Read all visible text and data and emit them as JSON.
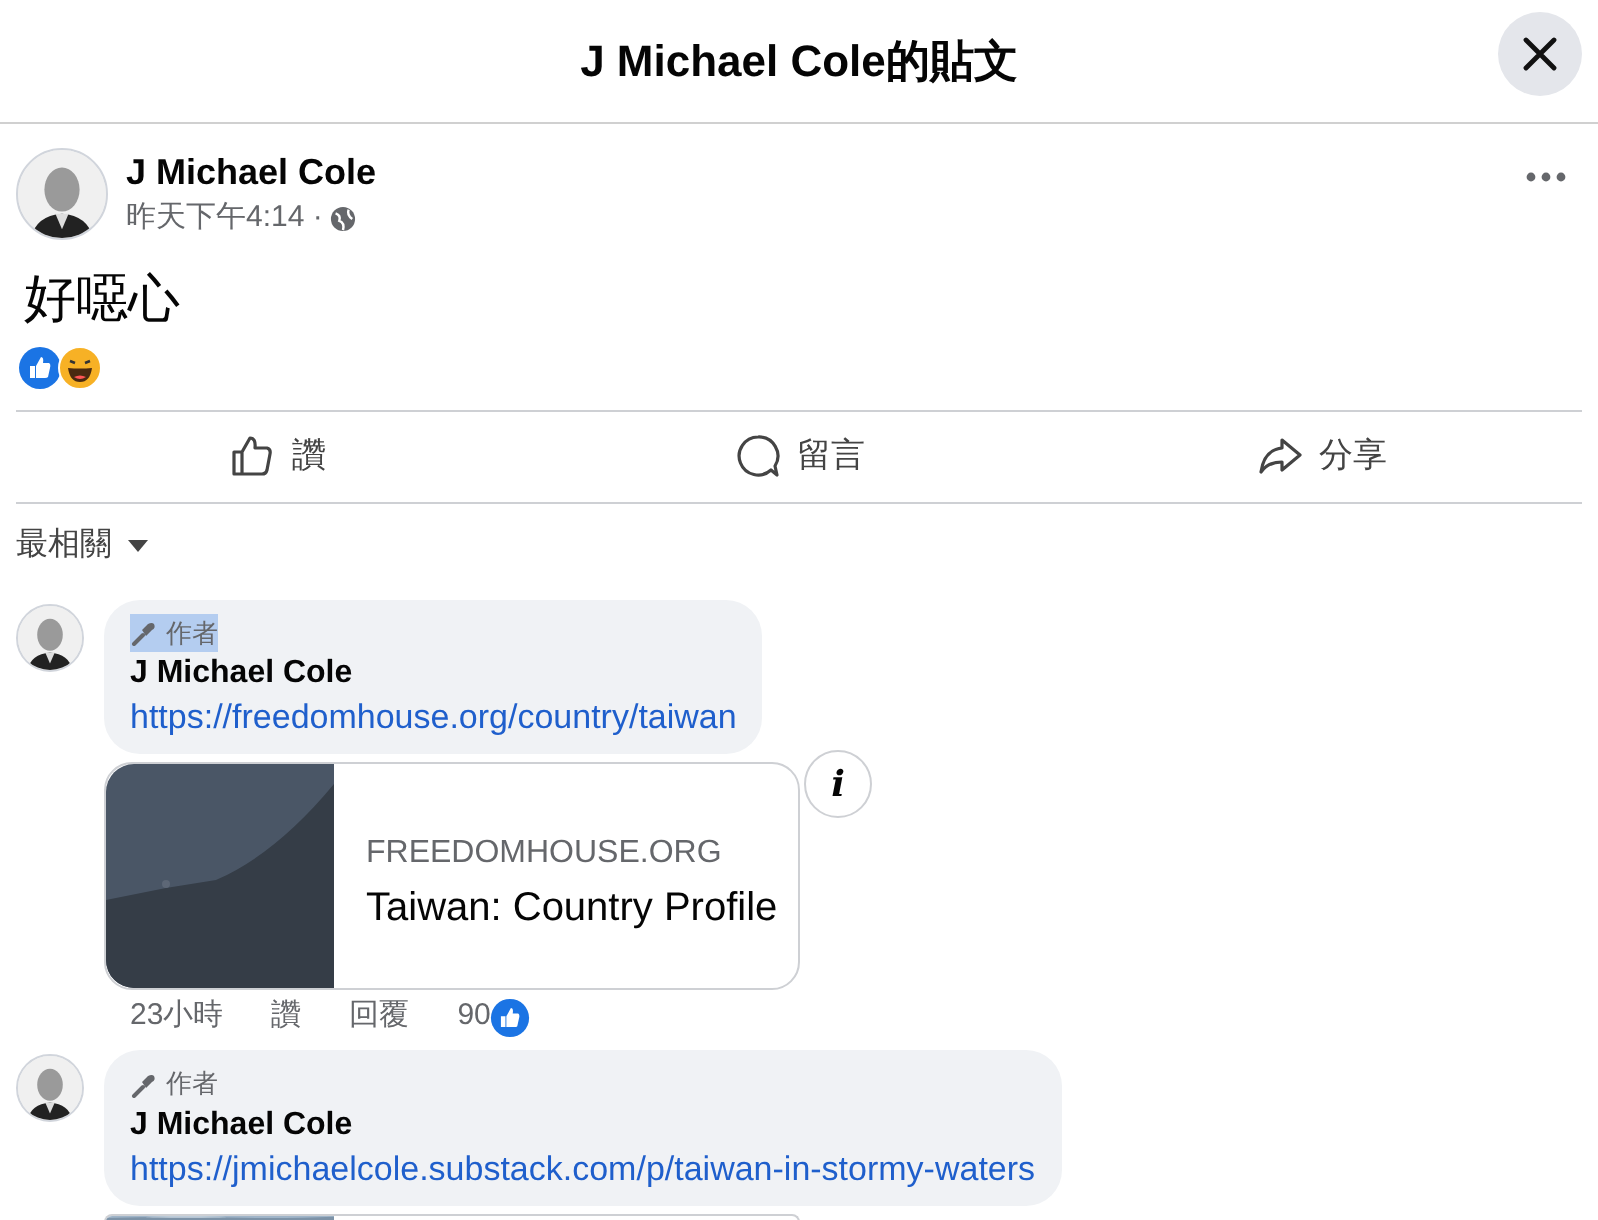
{
  "header": {
    "title": "J Michael Cole的貼文"
  },
  "post": {
    "author": "J Michael Cole",
    "time": "昨天下午4:14 ·",
    "text": "好噁心"
  },
  "actions": [
    {
      "kind": "like",
      "label": "讚"
    },
    {
      "kind": "comment",
      "label": "留言"
    },
    {
      "kind": "share",
      "label": "分享"
    }
  ],
  "sort": {
    "label": "最相關"
  },
  "comments": [
    {
      "badge": "作者",
      "highlighted": true,
      "author": "J Michael Cole",
      "link": "https://freedomhouse.org/country/taiwan",
      "preview": {
        "kind": "link",
        "source": "FREEDOMHOUSE.ORG",
        "title": "Taiwan: Country Profile",
        "info_label": "i"
      },
      "meta": {
        "age": "23小時",
        "like": "讚",
        "reply": "回覆",
        "likes": "90"
      }
    },
    {
      "badge": "作者",
      "highlighted": false,
      "author": "J Michael Cole",
      "link": "https://jmichaelcole.substack.com/p/taiwan-in-stormy-waters"
    }
  ]
}
